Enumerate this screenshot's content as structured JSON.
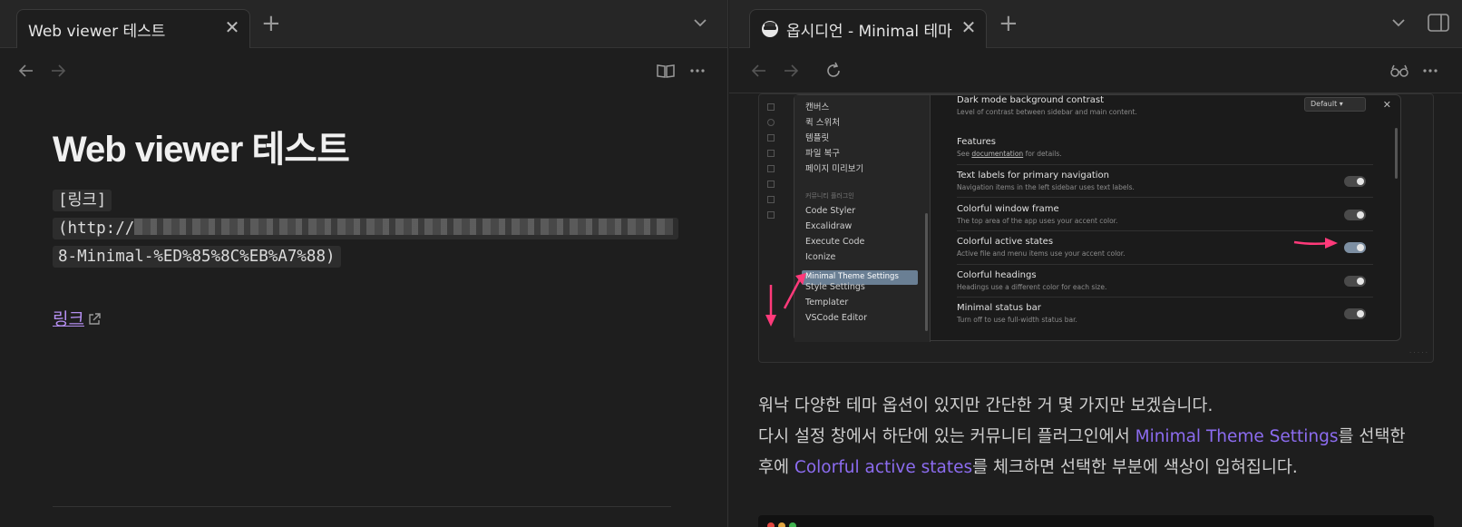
{
  "left": {
    "tab": {
      "title": "Web viewer 테스트"
    },
    "doc": {
      "title": "Web viewer 테스트",
      "code_lines": [
        "[링크]",
        "(http://",
        "8-Minimal-%ED%85%8C%EB%A7%88)"
      ],
      "link_text": "링크"
    },
    "icons": [
      "back-arrow-icon",
      "forward-arrow-icon",
      "reading-view-icon",
      "more-options-icon",
      "new-tab-icon",
      "tab-list-chevron-icon",
      "close-icon"
    ]
  },
  "right": {
    "tab": {
      "title": "옵시디언 - Minimal 테마"
    },
    "settings_shot": {
      "left_items": [
        "캔버스",
        "퀵 스위처",
        "템플릿",
        "파일 복구",
        "페이지 미리보기",
        "커뮤니티 플러그인",
        "Code Styler",
        "Excalidraw",
        "Execute Code",
        "Iconize",
        "Minimal Theme Settings",
        "Style Settings",
        "Templater",
        "VSCode Editor"
      ],
      "rows": [
        {
          "title": "Dark mode background contrast",
          "desc": "Level of contrast between sidebar and main content."
        },
        {
          "title": "Features",
          "desc_pre": "See ",
          "desc_link": "documentation",
          "desc_post": " for details."
        },
        {
          "title": "Text labels for primary navigation",
          "desc": "Navigation items in the left sidebar uses text labels."
        },
        {
          "title": "Colorful window frame",
          "desc": "The top area of the app uses your accent color."
        },
        {
          "title": "Colorful active states",
          "desc": "Active file and menu items use your accent color."
        },
        {
          "title": "Colorful headings",
          "desc": "Headings use a different color for each size."
        },
        {
          "title": "Minimal status bar",
          "desc": "Turn off to use full-width status bar."
        }
      ],
      "dropdown_value": "Default",
      "toggles": {
        "text_labels": false,
        "window_frame": false,
        "active_states": true,
        "headings": false,
        "status_bar": false
      }
    },
    "paragraph": {
      "line1": "워낙 다양한 테마 옵션이 있지만 간단한 거 몇 가지만 보겠습니다.",
      "line2_pre": "다시 설정 창에서 하단에 있는 커뮤니티 플러그인에서 ",
      "line2_hl": "Minimal Theme Settings",
      "line2_post": "를 선택한",
      "line3_pre": "후에 ",
      "line3_hl": "Colorful active states",
      "line3_post": "를 체크하면 선택한 부분에 색상이 입혀집니다."
    },
    "colors": {
      "highlight": "#8c6cf0",
      "arrow": "#ff3a7a",
      "link": "#b48ef0"
    }
  }
}
